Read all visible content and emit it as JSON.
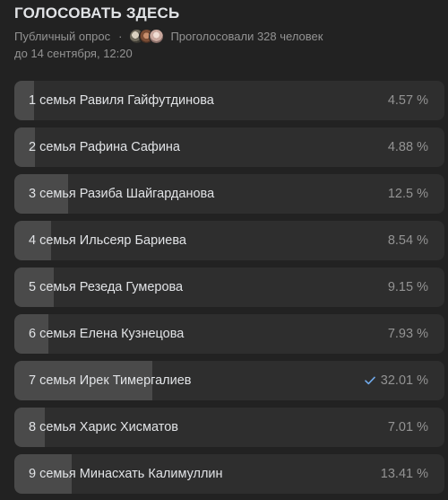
{
  "poll": {
    "title": "ГОЛОСОВАТЬ ЗДЕСЬ",
    "type_label": "Публичный опрос",
    "separator": "·",
    "voters_text": "Проголосовали 328 человек",
    "deadline": "до 14 сентября, 12:20",
    "avatars": [
      "voter-avatar-1",
      "voter-avatar-2",
      "voter-avatar-3"
    ],
    "options": [
      {
        "label": "1 семья Равиля Гайфутдинова",
        "percent_text": "4.57 %",
        "percent": 4.57,
        "voted": false
      },
      {
        "label": "2 семья Рафина Сафина",
        "percent_text": "4.88 %",
        "percent": 4.88,
        "voted": false
      },
      {
        "label": "3 семья Разиба Шайгарданова",
        "percent_text": "12.5 %",
        "percent": 12.5,
        "voted": false
      },
      {
        "label": "4 семья Ильсеяр Бариева",
        "percent_text": "8.54 %",
        "percent": 8.54,
        "voted": false
      },
      {
        "label": "5 семья Резеда Гумерова",
        "percent_text": "9.15 %",
        "percent": 9.15,
        "voted": false
      },
      {
        "label": "6 семья Елена Кузнецова",
        "percent_text": "7.93 %",
        "percent": 7.93,
        "voted": false
      },
      {
        "label": "7 семья Ирек Тимергалиев",
        "percent_text": "32.01 %",
        "percent": 32.01,
        "voted": true
      },
      {
        "label": "8 семья Харис Хисматов",
        "percent_text": "7.01 %",
        "percent": 7.01,
        "voted": false
      },
      {
        "label": "9 семья Минасхать Калимуллин",
        "percent_text": "13.41 %",
        "percent": 13.41,
        "voted": false
      }
    ]
  },
  "colors": {
    "background": "#222222",
    "option_background": "#2e2e2e",
    "option_fill": "#4a4a4a",
    "text_primary": "#e1e3e6",
    "text_secondary": "#939393",
    "check": "#71aaeb"
  }
}
